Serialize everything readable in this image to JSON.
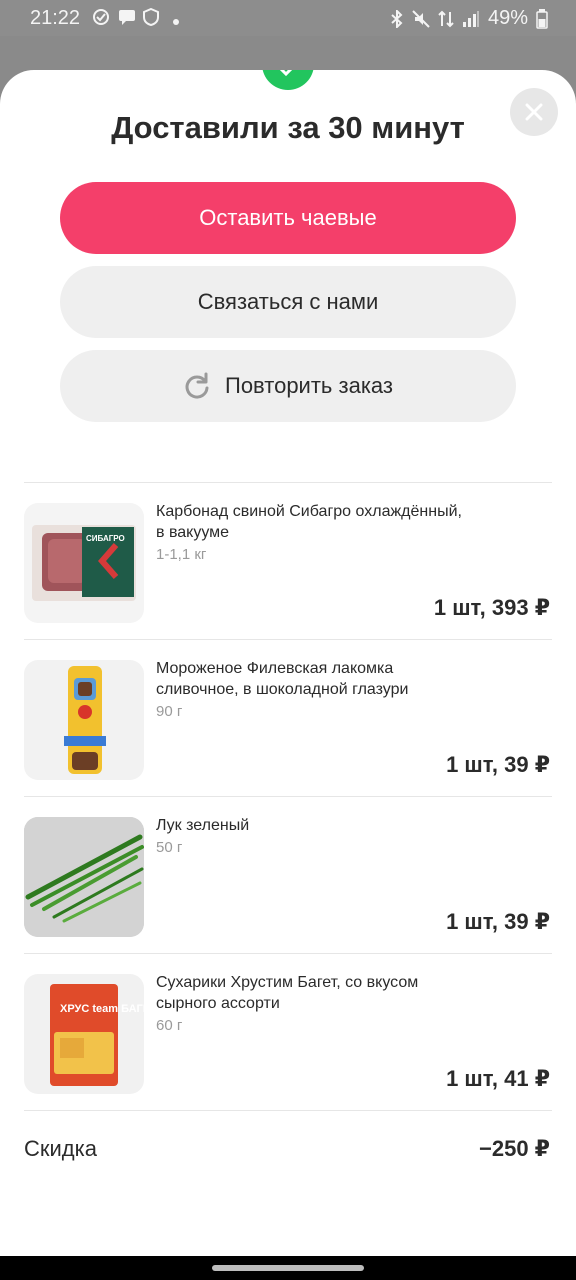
{
  "status_bar": {
    "time": "21:22",
    "battery": "49%"
  },
  "sheet": {
    "title": "Доставили за 30 минут"
  },
  "buttons": {
    "tip": "Оставить чаевые",
    "contact": "Связаться с нами",
    "repeat": "Повторить заказ"
  },
  "items": [
    {
      "name": "Карбонад свиной Сибагро охлаждённый, в вакууме",
      "weight": "1-1,1 кг",
      "price": "1 шт, 393 ₽",
      "package_text": "СИБАГРО"
    },
    {
      "name": "Мороженое Филевская лакомка сливочное, в шоколадной глазури",
      "weight": "90 г",
      "price": "1 шт, 39 ₽"
    },
    {
      "name": "Лук зеленый",
      "weight": "50 г",
      "price": "1 шт, 39 ₽"
    },
    {
      "name": "Сухарики Хрустим Багет, со вкусом сырного ассорти",
      "weight": "60 г",
      "price": "1 шт, 41 ₽",
      "package_text": "ХРУС team БАГЕТ"
    }
  ],
  "discount": {
    "label": "Скидка",
    "value": "−250 ₽"
  },
  "colors": {
    "accent": "#f43f6a",
    "success": "#22c55e",
    "button_bg": "#efefef"
  },
  "icons": [
    "check-icon",
    "close-icon",
    "repeat-icon"
  ]
}
